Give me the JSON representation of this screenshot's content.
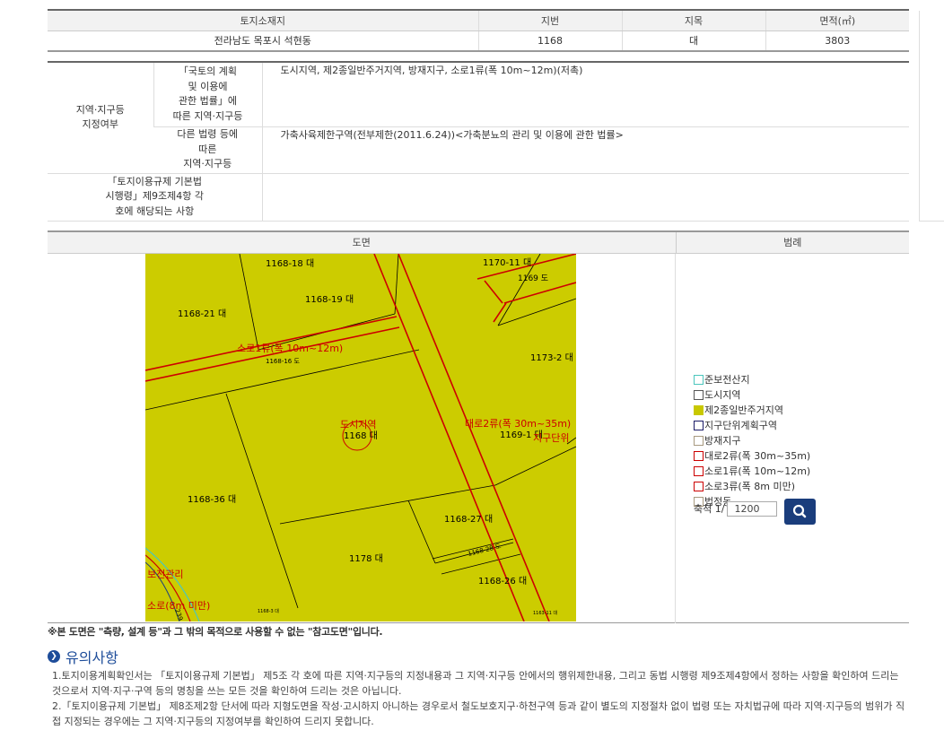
{
  "land_table": {
    "headers": [
      "토지소재지",
      "지번",
      "지목",
      "면적(㎡)"
    ],
    "row": {
      "address": "전라남도 목포시 석현동",
      "lot_number": "1168",
      "land_category": "대",
      "area": "3803"
    }
  },
  "zone_table": {
    "main_label": "지역·지구등\n지정여부",
    "rows": [
      {
        "label": "「국토의 계획\n및 이용에\n관한 법률」에\n따른 지역·지구등",
        "value": "도시지역, 제2종일반주거지역, 방재지구, 소로1류(폭 10m~12m)(저촉)"
      },
      {
        "label": "다른 법령 등에\n따른\n지역·지구등",
        "value": "가축사육제한구역(전부제한(2011.6.24))<가축분뇨의 관리 및 이용에 관한 법률>"
      }
    ],
    "regulation_label": "「토지이용규제 기본법\n시행령」제9조제4항 각\n호에 해당되는 사항",
    "regulation_value": ""
  },
  "map_section": {
    "headers": [
      "도면",
      "범례"
    ],
    "map_labels": {
      "p1168_18": "1168-18 대",
      "p1170_11": "1170-11 대",
      "p1169": "1169 도",
      "p1168_19": "1168-19 대",
      "p1168_21": "1168-21 대",
      "road_small": "소로1류(폭 10m~12m)",
      "p1168_16": "1168-16 도",
      "p1173_2": "1173-2 대",
      "urban": "도시지역",
      "p1168": "1168 대",
      "road_big": "대로2류(폭 30m~35m)",
      "p1169_1": "1169-1 대",
      "district": "지구단위",
      "p1168_36": "1168-36 대",
      "p1168_27": "1168-27 대",
      "p1168_28": "1168-28 도",
      "p1178": "1178 대",
      "p1168_26": "1168-26 대",
      "conserve": "보전관리",
      "road_tiny": "소로(8m 미만)",
      "p239": "239 전",
      "p1168_3": "1168-3 대",
      "p1163_11": "1163-11 대"
    },
    "legend": [
      {
        "label": "준보전산지",
        "color": "#4bc6bd",
        "fill": "#ffffff"
      },
      {
        "label": "도시지역",
        "color": "#555555",
        "fill": "#ffffff"
      },
      {
        "label": "제2종일반주거지역",
        "color": "#c8c800",
        "fill": "#c8c800"
      },
      {
        "label": "지구단위계획구역",
        "color": "#1a1a66",
        "fill": "#ffffff"
      },
      {
        "label": "방재지구",
        "color": "#a89a80",
        "fill": "#ffffff"
      },
      {
        "label": "대로2류(폭 30m~35m)",
        "color": "#cc0000",
        "fill": "#ffffff"
      },
      {
        "label": "소로1류(폭 10m~12m)",
        "color": "#cc0000",
        "fill": "#ffffff"
      },
      {
        "label": "소로3류(폭 8m 미만)",
        "color": "#cc0000",
        "fill": "#ffffff"
      },
      {
        "label": "법정동",
        "color": "#a89a80",
        "fill": "#ffffff"
      }
    ],
    "scale_label": "축척 1/",
    "scale_value": "1200",
    "search_icon": "search-icon"
  },
  "note": "※본 도면은 \"측량, 설계 등\"과 그 밖의 목적으로 사용할 수 없는 \"참고도면\"입니다.",
  "caution": {
    "title": "유의사항",
    "items": [
      "1.토지이용계획확인서는 「토지이용규제 기본법」 제5조 각 호에 따른 지역·지구등의 지정내용과 그 지역·지구등 안에서의 행위제한내용, 그리고 동법 시행령 제9조제4항에서 정하는 사항을 확인하여 드리는 것으로서 지역·지구·구역 등의 명칭을 쓰는 모든 것을 확인하여 드리는 것은 아닙니다.",
      "2.「토지이용규제 기본법」 제8조제2항 단서에 따라 지형도면을 작성·고시하지 아니하는 경우로서 철도보호지구·하천구역 등과 같이 별도의 지정절차 없이 법령 또는 자치법규에 따라 지역·지구등의 범위가 직접 지정되는 경우에는 그 지역·지구등의 지정여부를 확인하여 드리지 못합니다."
    ]
  }
}
